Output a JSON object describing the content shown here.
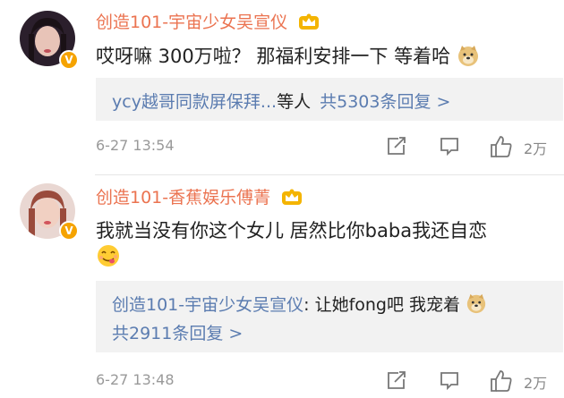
{
  "comments": [
    {
      "username": "创造101-宇宙少女吴宣仪",
      "text": "哎呀嘛 300万啦？ 那福利安排一下 等着哈",
      "emoji": "doge-emoji",
      "reply_preview": {
        "author": "ycy越哥同款屏保拜...",
        "suffix": "等人",
        "count_label": "共5303条回复 >"
      },
      "time": "6-27 13:54",
      "likes": "2万"
    },
    {
      "username": "创造101-香蕉娱乐傅菁",
      "text": "我就当没有你这个女儿 居然比你baba我还自恋",
      "emoji": "yummy-face-emoji",
      "reply": {
        "author": "创造101-宇宙少女吴宣仪",
        "separator": ":",
        "content": "让她fong吧 我宠着",
        "emoji": "doge-emoji",
        "count_label": "共2911条回复 >"
      },
      "time": "6-27 13:48",
      "likes": "2万"
    }
  ],
  "icons": {
    "verified_badge": "verified-v-badge",
    "crown": "vip-crown-icon",
    "share": "share-icon",
    "comment": "comment-icon",
    "like": "thumbs-up-icon"
  },
  "colors": {
    "username": "#eb7350",
    "link": "#5b7cb0",
    "meta": "#999999",
    "reply_bg": "#f2f2f2",
    "badge": "#f5a300"
  }
}
